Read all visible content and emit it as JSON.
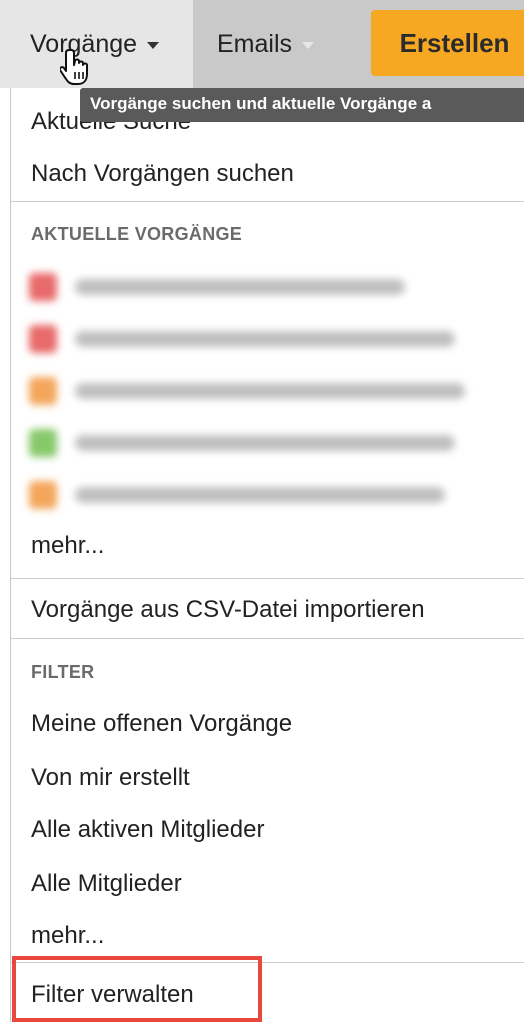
{
  "nav": {
    "vorgaenge_label": "Vorgänge",
    "emails_label": "Emails",
    "create_label": "Erstellen",
    "create_color": "#f7a823"
  },
  "tooltip": "Vorgänge suchen und aktuelle Vorgänge a",
  "menu": {
    "current_search": "Aktuelle Suche",
    "search_issues": "Nach Vorgängen suchen",
    "recent_heading": "AKTUELLE VORGÄNGE",
    "recent_items": [
      {
        "status_color": "#e86a6a"
      },
      {
        "status_color": "#e86a6a"
      },
      {
        "status_color": "#f3a65a"
      },
      {
        "status_color": "#86c96a"
      },
      {
        "status_color": "#f3a65a"
      }
    ],
    "recent_more": "mehr...",
    "import_csv": "Vorgänge aus CSV-Datei importieren",
    "filter_heading": "FILTER",
    "filters": [
      "Meine offenen Vorgänge",
      "Von mir erstellt",
      "Alle aktiven Mitglieder",
      "Alle Mitglieder"
    ],
    "filter_more": "mehr...",
    "manage_filters": "Filter verwalten"
  },
  "highlight_color": "#e8483d"
}
